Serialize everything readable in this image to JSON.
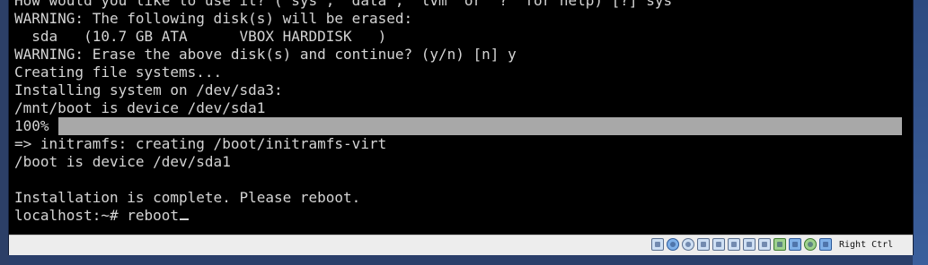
{
  "terminal": {
    "lines": [
      "How would you like to use it? ('sys', 'data', 'lvm' or '?' for help) [?] sys",
      "WARNING: The following disk(s) will be erased:",
      "  sda   (10.7 GB ATA      VBOX HARDDISK   )",
      "WARNING: Erase the above disk(s) and continue? (y/n) [n] y",
      "Creating file systems...",
      "Installing system on /dev/sda3:",
      "/mnt/boot is device /dev/sda1",
      "=> initramfs: creating /boot/initramfs-virt",
      "/boot is device /dev/sda1",
      "",
      "Installation is complete. Please reboot.",
      "localhost:~# reboot"
    ],
    "progress": {
      "percent_label": "100%",
      "fraction": 1.0
    }
  },
  "statusbar": {
    "icons": [
      "hard-disk-icon",
      "optical-drive-icon",
      "audio-icon",
      "network-icon",
      "usb-icon",
      "shared-folders-icon",
      "display-icon",
      "video-capture-icon",
      "guest-additions-icon",
      "mouse-integration-icon",
      "cpu-activity-icon",
      "keyboard-capture-icon"
    ],
    "host_key": "Right Ctrl"
  }
}
